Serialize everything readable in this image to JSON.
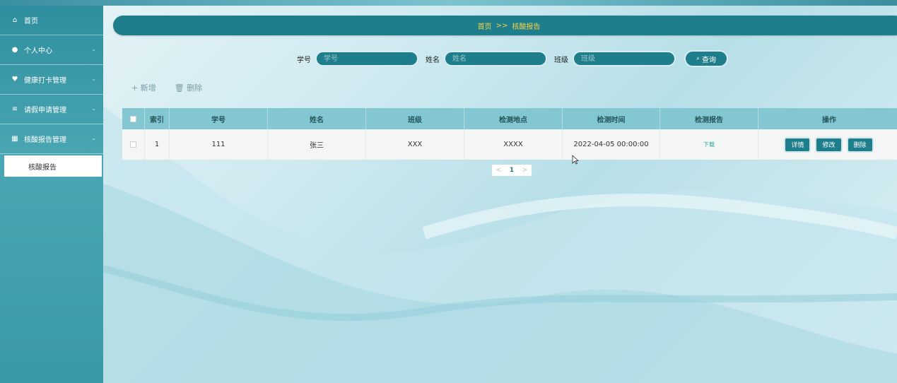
{
  "sidebar": {
    "items": [
      {
        "label": "首页",
        "icon": "home-icon",
        "glyph": "⌂",
        "chevron": ""
      },
      {
        "label": "个人中心",
        "icon": "user-icon",
        "glyph": "●",
        "chevron": "⌄"
      },
      {
        "label": "健康打卡管理",
        "icon": "health-icon",
        "glyph": "♥",
        "chevron": "⌄"
      },
      {
        "label": "请假申请管理",
        "icon": "list-icon",
        "glyph": "≡",
        "chevron": "⌄"
      },
      {
        "label": "核酸报告管理",
        "icon": "grid-icon",
        "glyph": "▦",
        "chevron": "⌄"
      }
    ],
    "submenu": {
      "label": "核酸报告"
    }
  },
  "breadcrumb": {
    "home": "首页",
    "sep": ">>",
    "current": "核酸报告"
  },
  "search": {
    "student_id_label": "学号",
    "student_id_placeholder": "学号",
    "name_label": "姓名",
    "name_placeholder": "姓名",
    "class_label": "班级",
    "class_placeholder": "班级",
    "button_label": "查询"
  },
  "actions": {
    "add": "+ 新增",
    "delete": "删除"
  },
  "table": {
    "headers": {
      "index": "索引",
      "student_id": "学号",
      "name": "姓名",
      "class": "班级",
      "location": "检测地点",
      "time": "检测时间",
      "report": "检测报告",
      "ops": "操作"
    },
    "rows": [
      {
        "index": "1",
        "student_id": "111",
        "name": "张三",
        "class": "XXX",
        "location": "XXXX",
        "time": "2022-04-05 00:00:00",
        "report": "下载"
      }
    ],
    "op_labels": {
      "detail": "详情",
      "edit": "修改",
      "delete": "删除"
    }
  },
  "pagination": {
    "prev": "<",
    "page": "1",
    "next": ">"
  },
  "colors": {
    "primary": "#1f7e8b",
    "header": "#83c7d2",
    "breadcrumb_text": "#f3d24b"
  }
}
